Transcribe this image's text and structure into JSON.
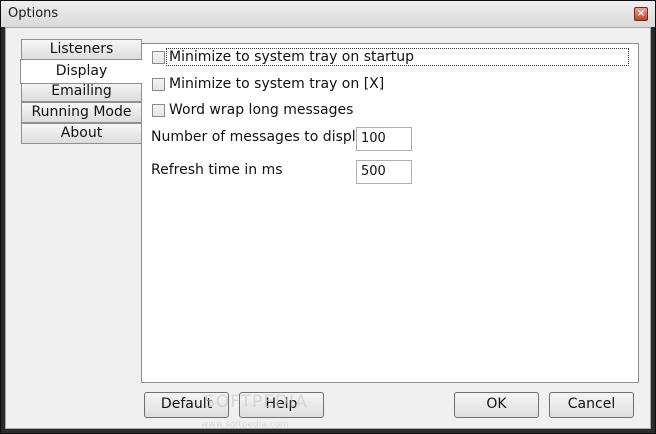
{
  "window": {
    "title": "Options",
    "close_glyph": "×"
  },
  "tabs": [
    {
      "label": "Listeners",
      "selected": false
    },
    {
      "label": "Display",
      "selected": true
    },
    {
      "label": "Emailing",
      "selected": false
    },
    {
      "label": "Running Mode",
      "selected": false
    },
    {
      "label": "About",
      "selected": false
    }
  ],
  "display": {
    "checkboxes": [
      {
        "label": "Minimize to system tray on startup",
        "checked": false
      },
      {
        "label": "Minimize to system tray on [X]",
        "checked": false
      },
      {
        "label": "Word wrap long messages",
        "checked": false
      }
    ],
    "fields": [
      {
        "label": "Number of messages to display",
        "value": "100"
      },
      {
        "label": "Refresh time in ms",
        "value": "500"
      }
    ]
  },
  "buttons": {
    "default": "Default",
    "help": "Help",
    "ok": "OK",
    "cancel": "Cancel"
  },
  "watermark": {
    "text": "SOFTPEDIA",
    "sub": "www.softpedia.com"
  }
}
